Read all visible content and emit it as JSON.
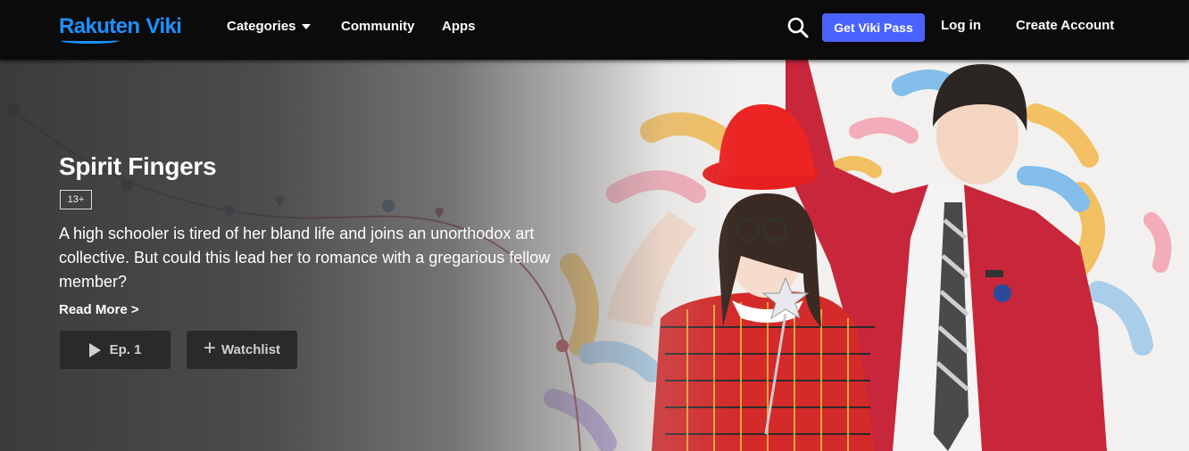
{
  "brand": {
    "part1": "Rakuten",
    "part2": "Viki",
    "color": "#1e90ff"
  },
  "nav": {
    "categories": "Categories",
    "community": "Community",
    "apps": "Apps",
    "search_icon": "search-icon",
    "viki_pass": "Get Viki Pass",
    "viki_pass_color": "#4a63ff",
    "login": "Log in",
    "create_account": "Create Account"
  },
  "hero": {
    "title": "Spirit Fingers",
    "rating": "13+",
    "synopsis": "A high schooler is tired of her bland life and joins an unorthodox art collective. But could this lead her to romance with a gregarious fellow member?",
    "read_more": "Read More >",
    "episode_button": "Ep. 1",
    "watchlist_button": "Watchlist",
    "play_icon": "play-icon",
    "plus_icon": "plus-icon"
  }
}
